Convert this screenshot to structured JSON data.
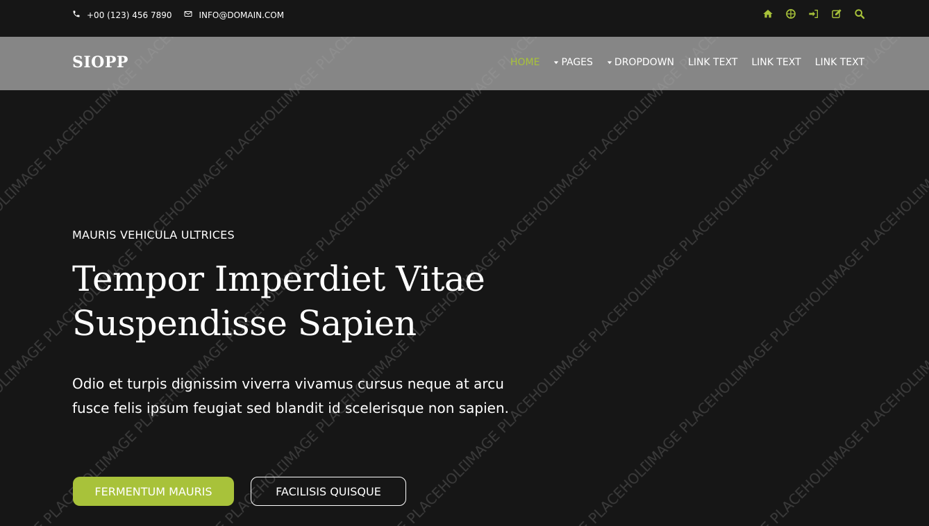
{
  "colors": {
    "background": "#161616",
    "accent": "#a8c23a",
    "navbar": "#a6a6a6"
  },
  "topbar": {
    "phone": "+00 (123) 456 7890",
    "email": "INFO@DOMAIN.COM",
    "icons": [
      "home-icon",
      "globe-icon",
      "sign-in-icon",
      "edit-icon",
      "search-icon"
    ]
  },
  "navbar": {
    "brand": "SIOPP",
    "items": [
      {
        "label": "HOME",
        "active": true
      },
      {
        "label": "PAGES",
        "dropdown": true
      },
      {
        "label": "DROPDOWN",
        "dropdown": true
      },
      {
        "label": "LINK TEXT"
      },
      {
        "label": "LINK TEXT"
      },
      {
        "label": "LINK TEXT"
      }
    ]
  },
  "hero": {
    "eyebrow": "MAURIS VEHICULA ULTRICES",
    "title_line1": "Tempor Imperdiet Vitae",
    "title_line2": "Suspendisse Sapien",
    "lead": "Odio et turpis dignissim viverra vivamus cursus neque at arcu fusce felis ipsum feugiat sed blandit id scelerisque non sapien.",
    "primary_button": "FERMENTUM MAURIS",
    "secondary_button": "FACILISIS QUISQUE"
  },
  "watermark": "IMAGE PLACEHOLDER"
}
